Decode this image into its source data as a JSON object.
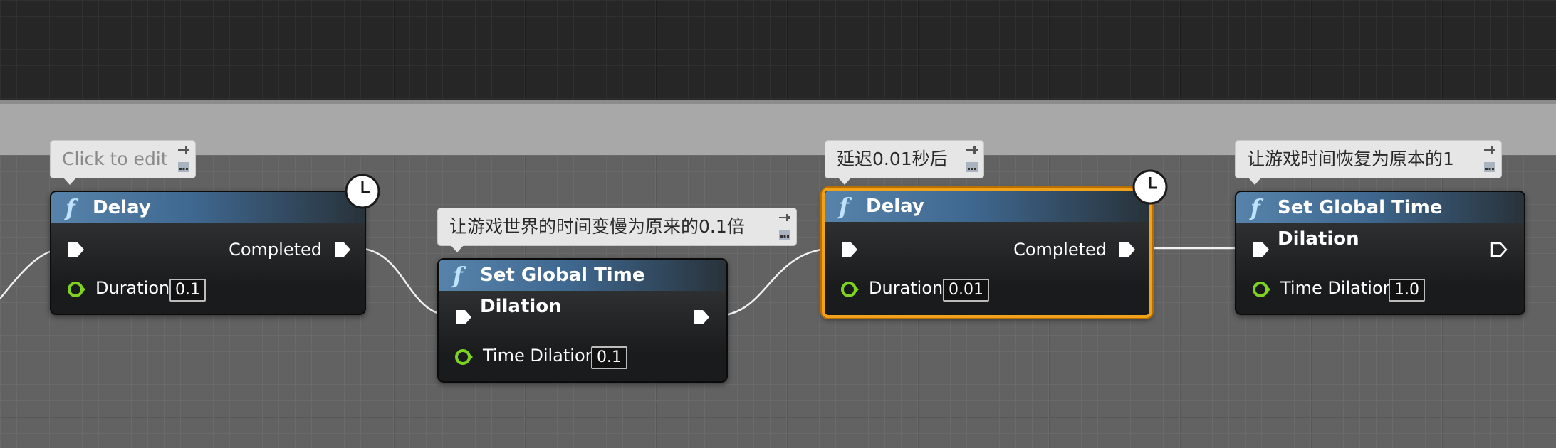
{
  "comments": {
    "delay1": "Click to edit",
    "set1": "让游戏世界的时间变慢为原来的0.1倍",
    "delay2": "延迟0.01秒后",
    "set2": "让游戏时间恢复为原本的1"
  },
  "nodes": {
    "delay1": {
      "title": "Delay",
      "completed_label": "Completed",
      "duration_label": "Duration",
      "duration_value": "0.1"
    },
    "set1": {
      "title": "Set Global Time Dilation",
      "param_label": "Time Dilation",
      "param_value": "0.1"
    },
    "delay2": {
      "title": "Delay",
      "completed_label": "Completed",
      "duration_label": "Duration",
      "duration_value": "0.01"
    },
    "set2": {
      "title": "Set Global Time Dilation",
      "param_label": "Time Dilation",
      "param_value": "1.0"
    }
  },
  "icons": {
    "function": "f",
    "latent": "clock-icon",
    "comment_pin": "pin-icon",
    "comment_expand": "expand-icon"
  },
  "colors": {
    "selection": "#f0a21a",
    "header_function": "#5783ab",
    "float_pin": "#7ed321",
    "comment_bubble": "#e6e6e6"
  }
}
